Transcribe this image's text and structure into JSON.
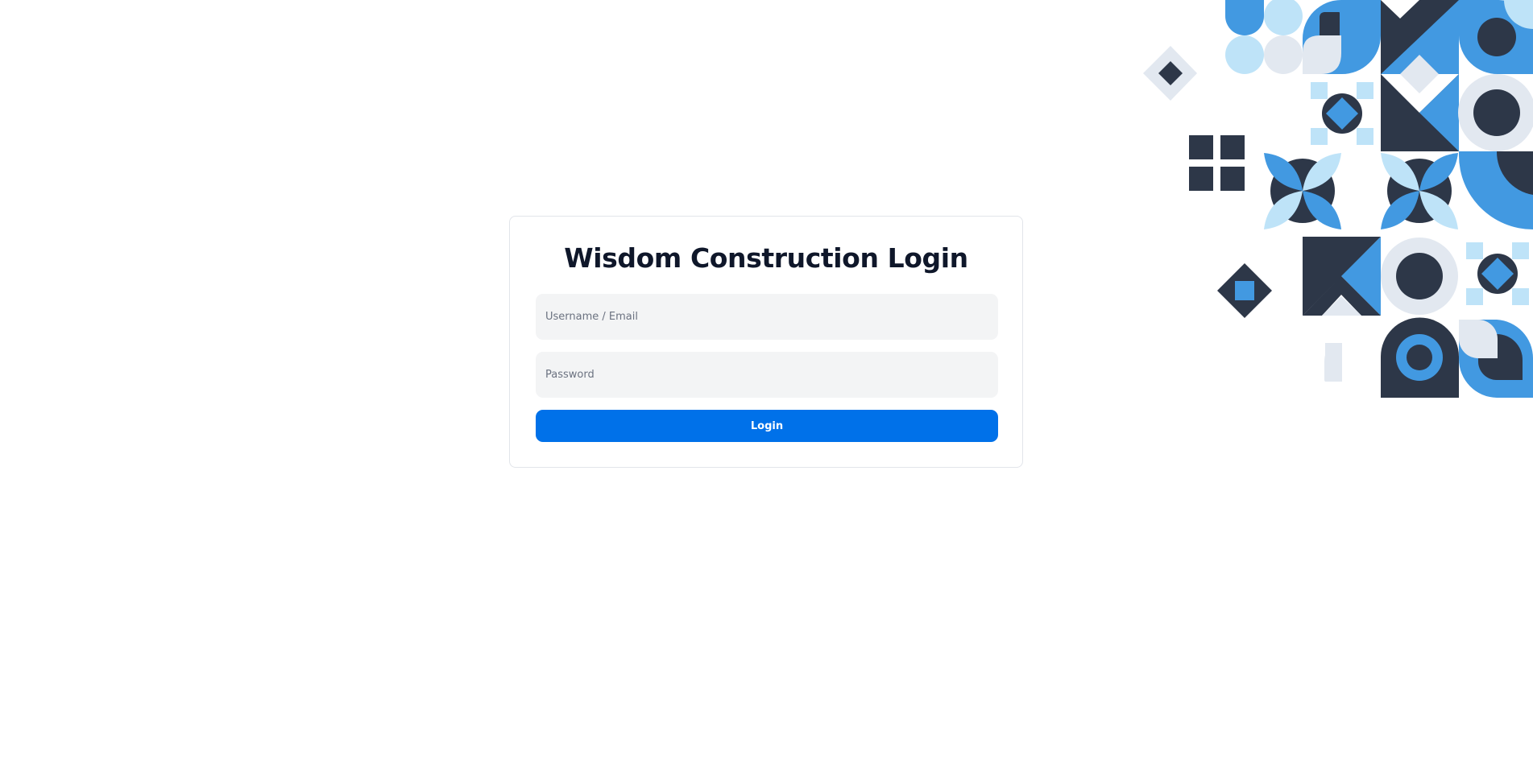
{
  "login": {
    "title": "Wisdom Construction Login",
    "username_placeholder": "Username / Email",
    "username_value": "",
    "password_placeholder": "Password",
    "password_value": "",
    "button_label": "Login"
  },
  "colors": {
    "navy": "#2d3748",
    "blue": "#4299e1",
    "light_blue": "#bee3f8",
    "light_gray": "#e2e8f0",
    "button": "#0071e9",
    "title": "#0f172a"
  }
}
